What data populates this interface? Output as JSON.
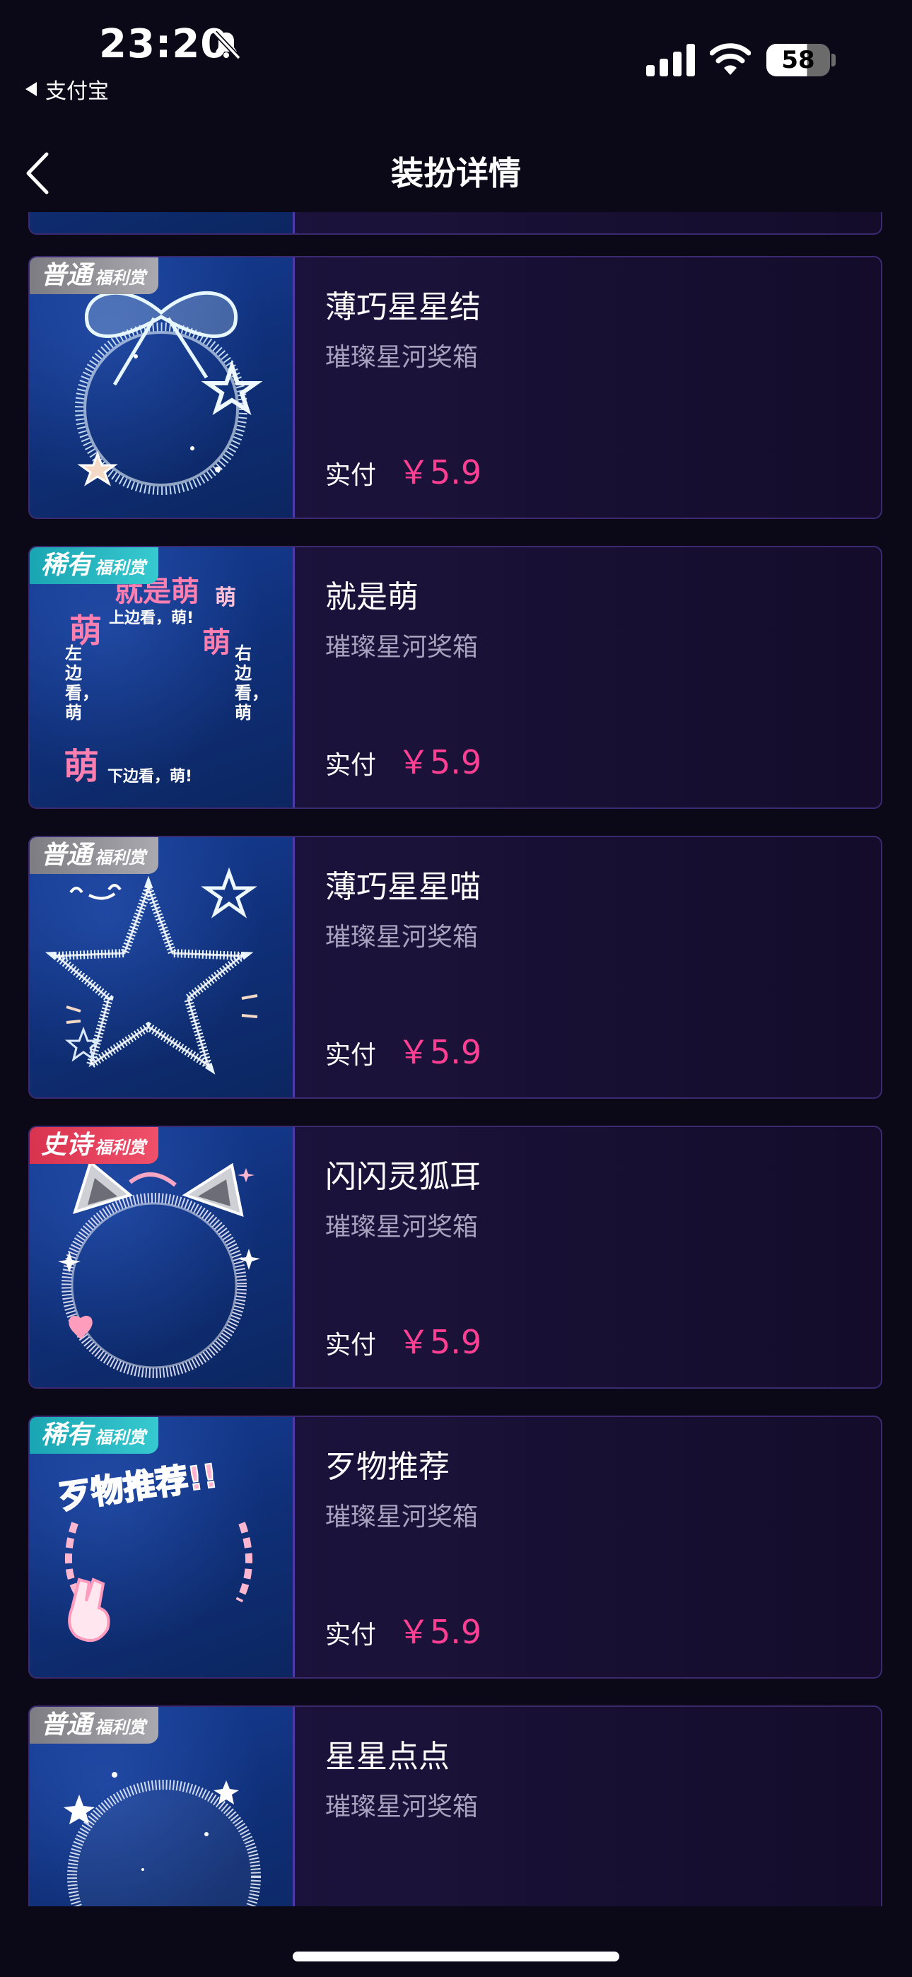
{
  "status_bar": {
    "time": "23:20",
    "back_app": "支付宝",
    "battery": "58"
  },
  "nav": {
    "title": "装扮详情"
  },
  "items": [
    {
      "badge_tier": "普通",
      "badge_sub": "福利赏",
      "name": "薄巧星星结",
      "source": "璀璨星河奖箱",
      "price_label": "实付",
      "price": "￥5.9",
      "frame": "bow-ring"
    },
    {
      "badge_tier": "稀有",
      "badge_sub": "福利赏",
      "name": "就是萌",
      "source": "璀璨星河奖箱",
      "price_label": "实付",
      "price": "￥5.9",
      "frame": "text-frame",
      "frame_text": {
        "top": "就是萌",
        "top_side": "萌",
        "left_big": "萌",
        "top_small": "上边看，萌!",
        "left_vert": "左边看，萌",
        "right_vert": "右边看，萌",
        "bottom_big": "萌",
        "bottom_small": "下边看，萌!"
      }
    },
    {
      "badge_tier": "普通",
      "badge_sub": "福利赏",
      "name": "薄巧星星喵",
      "source": "璀璨星河奖箱",
      "price_label": "实付",
      "price": "￥5.9",
      "frame": "star"
    },
    {
      "badge_tier": "史诗",
      "badge_sub": "福利赏",
      "name": "闪闪灵狐耳",
      "source": "璀璨星河奖箱",
      "price_label": "实付",
      "price": "￥5.9",
      "frame": "fox-ears"
    },
    {
      "badge_tier": "稀有",
      "badge_sub": "福利赏",
      "name": "歹物推荐",
      "source": "璀璨星河奖箱",
      "price_label": "实付",
      "price": "￥5.9",
      "frame": "recommend",
      "frame_text": "歹物推荐!!"
    },
    {
      "badge_tier": "普通",
      "badge_sub": "福利赏",
      "name": "星星点点",
      "source": "璀璨星河奖箱",
      "price_label": "实付",
      "price": "￥5.9",
      "frame": "dots-ring"
    }
  ]
}
